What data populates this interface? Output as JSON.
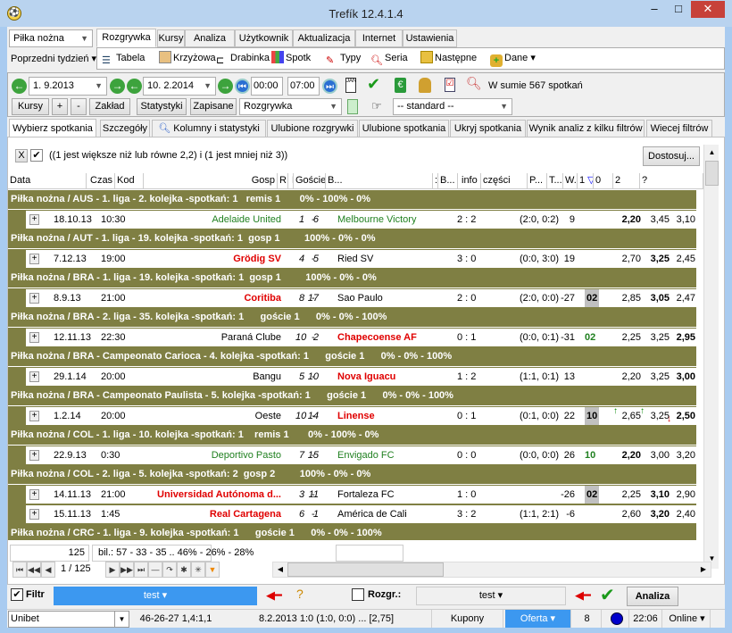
{
  "window": {
    "title": "Trefík 12.4.1.4"
  },
  "sport_select": "Piłka nożna",
  "main_tabs": [
    "Rozgrywka",
    "Kursy",
    "Analiza",
    "Użytkownik",
    "Aktualizacja",
    "Internet",
    "Ustawienia"
  ],
  "period_select": "Poprzedni tydzień",
  "toolbar": [
    "Tabela",
    "Krzyżowa",
    "Drabinka",
    "Spotk",
    "Typy",
    "Seria",
    "Następne",
    "Dane"
  ],
  "dates": {
    "from": "1. 9.2013",
    "to": "10. 2.2014",
    "time_from": "00:00",
    "time_to": "07:00",
    "total": "W sumie 567 spotkań"
  },
  "buttons": {
    "kursy": "Kursy",
    "plus": "+",
    "minus": "-",
    "zaklad": "Zakład",
    "statystyki": "Statystyki",
    "zapisane": "Zapisane",
    "rozgrywka_select": "Rozgrywka",
    "standard_select": "-- standard --"
  },
  "sub_tabs": [
    "Wybierz spotkania",
    "Szczegóły",
    "Kolumny i statystyki",
    "Ulubione rozgrywki",
    "Ulubione spotkania",
    "Ukryj spotkania",
    "Wynik analiz z kilku filtrów",
    "Wiecej filtrów"
  ],
  "filter": {
    "expression": "((1 jest większe niż lub równe 2,2) i (1 jest mniej niż 3))",
    "adjust": "Dostosuj..."
  },
  "columns": [
    "Data",
    "Czas",
    "Kod",
    "Gosp",
    "R...",
    "R...",
    "Goście",
    "B...",
    ":",
    "B...",
    "info",
    "części",
    "P...",
    "T...",
    "W.",
    "1",
    "0",
    "2",
    "?"
  ],
  "rows": [
    {
      "type": "group",
      "text": "Piłka nożna / AUS - 1. liga - 2. kolejka -spotkań: 1   remis 1       0% - 100% - 0%"
    },
    {
      "type": "match",
      "date": "18.10.13",
      "time": "10:30",
      "home": "Adelaide United",
      "hc": "green",
      "r1": "1",
      "r2": "6",
      "away": "Melbourne Victory",
      "ac": "green",
      "score": "2 : 2",
      "parts": "(2:0, 0:2)",
      "p": "9",
      "t": "",
      "tc": "",
      "o1": "2,20",
      "o0": "3,45",
      "o2": "3,10",
      "q": "N",
      "bold": "0"
    },
    {
      "type": "group",
      "text": "Piłka nożna / AUT - 1. liga - 19. kolejka -spotkań: 1  gosp 1         100% - 0% - 0%"
    },
    {
      "type": "match",
      "date": "7.12.13",
      "time": "19:00",
      "home": "Grödig SV",
      "hc": "red",
      "r1": "4",
      "r2": "5",
      "away": "Ried SV",
      "ac": "",
      "score": "3 : 0",
      "parts": "(0:0, 3:0)",
      "p": "19",
      "t": "",
      "tc": "",
      "o1": "2,70",
      "o0": "3,25",
      "o2": "2,45",
      "q": "N",
      "bold": "1"
    },
    {
      "type": "group",
      "text": "Piłka nożna / BRA - 1. liga - 19. kolejka -spotkań: 1  gosp 1         100% - 0% - 0%"
    },
    {
      "type": "match",
      "date": "8.9.13",
      "time": "21:00",
      "home": "Coritiba",
      "hc": "red",
      "r1": "8",
      "r2": "17",
      "away": "Sao Paulo",
      "ac": "",
      "score": "2 : 0",
      "parts": "(2:0, 0:0)",
      "p": "-27",
      "t": "02",
      "tc": "tag",
      "o1": "2,85",
      "o0": "3,05",
      "o2": "2,47",
      "q": "N",
      "bold": "1"
    },
    {
      "type": "group",
      "text": "Piłka nożna / BRA - 2. liga - 35. kolejka -spotkań: 1      goście 1      0% - 0% - 100%"
    },
    {
      "type": "match",
      "date": "12.11.13",
      "time": "22:30",
      "home": "Paraná Clube",
      "hc": "",
      "r1": "10",
      "r2": "2",
      "away": "Chapecoense AF",
      "ac": "red",
      "score": "0 : 1",
      "parts": "(0:0, 0:1)",
      "p": "-31",
      "t": "02",
      "tc": "green b",
      "o1": "2,25",
      "o0": "3,25",
      "o2": "2,95",
      "q": "T",
      "bold": "2"
    },
    {
      "type": "group",
      "text": "Piłka nożna / BRA - Campeonato Carioca - 4. kolejka -spotkań: 1      goście 1      0% - 0% - 100%"
    },
    {
      "type": "match",
      "date": "29.1.14",
      "time": "20:00",
      "home": "Bangu",
      "hc": "",
      "r1": "5",
      "r2": "10",
      "away": "Nova Iguacu",
      "ac": "red",
      "score": "1 : 2",
      "parts": "(1:1, 0:1)",
      "p": "13",
      "t": "",
      "tc": "",
      "o1": "2,20",
      "o0": "3,25",
      "o2": "3,00",
      "q": "N",
      "bold": "2"
    },
    {
      "type": "group",
      "text": "Piłka nożna / BRA - Campeonato Paulista - 5. kolejka -spotkań: 1      goście 1      0% - 0% - 100%"
    },
    {
      "type": "match",
      "date": "1.2.14",
      "time": "20:00",
      "home": "Oeste",
      "hc": "",
      "r1": "10",
      "r2": "14",
      "away": "Linense",
      "ac": "red",
      "score": "0 : 1",
      "parts": "(0:1, 0:0)",
      "p": "22",
      "t": "10",
      "tc": "tag",
      "o1": "2,65",
      "o0": "3,25",
      "o2": "2,50",
      "q": "N",
      "bold": "2",
      "arrows": true
    },
    {
      "type": "group",
      "text": "Piłka nożna / COL - 1. liga - 10. kolejka -spotkań: 1    remis 1       0% - 100% - 0%"
    },
    {
      "type": "match",
      "date": "22.9.13",
      "time": "0:30",
      "home": "Deportivo Pasto",
      "hc": "green",
      "r1": "7",
      "r2": "15",
      "away": "Envigado FC",
      "ac": "green",
      "score": "0 : 0",
      "parts": "(0:0, 0:0)",
      "p": "26",
      "t": "10",
      "tc": "green b",
      "o1": "2,20",
      "o0": "3,00",
      "o2": "3,20",
      "q": "T",
      "bold": "0"
    },
    {
      "type": "group",
      "text": "Piłka nożna / COL - 2. liga - 5. kolejka -spotkań: 2  gosp 2         100% - 0% - 0%"
    },
    {
      "type": "match",
      "date": "14.11.13",
      "time": "21:00",
      "home": "Universidad Autónoma d...",
      "hc": "red",
      "r1": "3",
      "r2": "11",
      "away": "Fortaleza FC",
      "ac": "",
      "score": "1 : 0",
      "parts": "",
      "p": "-26",
      "t": "02",
      "tc": "tag",
      "o1": "2,25",
      "o0": "3,10",
      "o2": "2,90",
      "q": "N",
      "bold": "1"
    },
    {
      "type": "match",
      "date": "15.11.13",
      "time": "1:45",
      "home": "Real Cartagena",
      "hc": "red",
      "r1": "6",
      "r2": "1",
      "away": "América de Cali",
      "ac": "",
      "score": "3 : 2",
      "parts": "(1:1, 2:1)",
      "p": "-6",
      "t": "",
      "tc": "",
      "o1": "2,60",
      "o0": "3,20",
      "o2": "2,40",
      "q": "N",
      "bold": "1"
    },
    {
      "type": "group",
      "text": "Piłka nożna / CRC - 1. liga - 9. kolejka -spotkań: 1      goście 1      0% - 0% - 100%"
    }
  ],
  "summary": {
    "count": "125",
    "bil": "bil.: 57 - 33 - 35 .. 46% - 26% - 28%"
  },
  "pager": "1 / 125",
  "bottom": {
    "filtr": "Filtr",
    "filtr_value": "test",
    "rozgr": "Rozgr.:",
    "rozgr_value": "test",
    "analiza": "Analiza"
  },
  "status": {
    "bookmaker": "Unibet",
    "stats": "46-26-27  1,4:1,1",
    "last": "8.2.2013 1:0 (1:0, 0:0) ... [2,75]",
    "kupony": "Kupony",
    "oferta": "Oferta",
    "count": "8",
    "time": "22:06",
    "online": "Online"
  }
}
